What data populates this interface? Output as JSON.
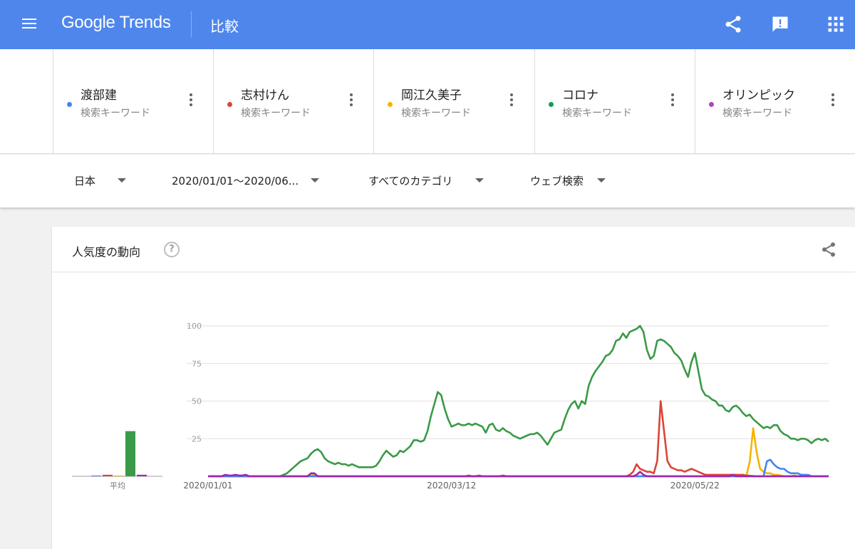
{
  "header": {
    "logo_text": "Google Trends",
    "title": "比較",
    "icons": [
      "menu-icon",
      "share-icon",
      "feedback-icon",
      "apps-icon"
    ],
    "color": "#4f86ec"
  },
  "terms": [
    {
      "name": "渡部建",
      "type": "検索キーワード",
      "color": "#4285f4"
    },
    {
      "name": "志村けん",
      "type": "検索キーワード",
      "color": "#db4437"
    },
    {
      "name": "岡江久美子",
      "type": "検索キーワード",
      "color": "#f4b400"
    },
    {
      "name": "コロナ",
      "type": "検索キーワード",
      "color": "#0f9d58"
    },
    {
      "name": "オリンピック",
      "type": "検索キーワード",
      "color": "#ab47bc"
    }
  ],
  "filters": {
    "region": "日本",
    "date_range": "2020/01/01〜2020/06...",
    "category": "すべてのカテゴリ",
    "search_type": "ウェブ検索"
  },
  "card": {
    "title": "人気度の動向"
  },
  "chart_data": [
    {
      "type": "bar",
      "xlabel": "平均",
      "categories": [
        "渡部建",
        "志村けん",
        "岡江久美子",
        "コロナ",
        "オリンピック"
      ],
      "values": [
        0.3,
        1,
        0.3,
        30,
        1
      ],
      "colors": [
        "#4285f4",
        "#db4437",
        "#f4b400",
        "#3a9a47",
        "#9c27b0"
      ],
      "ylim": [
        0,
        100
      ]
    },
    {
      "type": "line",
      "ylim": [
        0,
        100
      ],
      "yticks": [
        25,
        50,
        75,
        100
      ],
      "xticks": [
        "2020/01/01",
        "2020/03/12",
        "2020/05/22"
      ],
      "x_start": "2020/01/01",
      "x_end": "2020/06/30",
      "grid": true,
      "series": [
        {
          "name": "渡部建",
          "color": "#4285f4",
          "points": [
            [
              0,
              0
            ],
            [
              162,
              0
            ],
            [
              163,
              10
            ],
            [
              164,
              11
            ],
            [
              165,
              8
            ],
            [
              166,
              6
            ],
            [
              167,
              5
            ],
            [
              168,
              5
            ],
            [
              169,
              3
            ],
            [
              170,
              2
            ],
            [
              171,
              2
            ],
            [
              172,
              2
            ],
            [
              173,
              1
            ],
            [
              174,
              1
            ],
            [
              175,
              1
            ],
            [
              176,
              0
            ],
            [
              181,
              0
            ]
          ]
        },
        {
          "name": "志村けん",
          "color": "#db4437",
          "points": [
            [
              0,
              0
            ],
            [
              75,
              0
            ],
            [
              76,
              0.5
            ],
            [
              77,
              0
            ],
            [
              78,
              0
            ],
            [
              79,
              0.5
            ],
            [
              80,
              0
            ],
            [
              85,
              0
            ],
            [
              86,
              0.5
            ],
            [
              87,
              0
            ],
            [
              122,
              0
            ],
            [
              123,
              1
            ],
            [
              124,
              3
            ],
            [
              125,
              8
            ],
            [
              126,
              5
            ],
            [
              127,
              4
            ],
            [
              128,
              3
            ],
            [
              129,
              3
            ],
            [
              130,
              2
            ],
            [
              131,
              10
            ],
            [
              132,
              50
            ],
            [
              133,
              30
            ],
            [
              134,
              10
            ],
            [
              135,
              6
            ],
            [
              136,
              5
            ],
            [
              137,
              4
            ],
            [
              138,
              4
            ],
            [
              139,
              3
            ],
            [
              140,
              4
            ],
            [
              141,
              5
            ],
            [
              142,
              4
            ],
            [
              143,
              3
            ],
            [
              144,
              2
            ],
            [
              145,
              1
            ],
            [
              146,
              1
            ],
            [
              150,
              1
            ],
            [
              156,
              1
            ],
            [
              157,
              0.5
            ],
            [
              160,
              0
            ],
            [
              181,
              0
            ]
          ]
        },
        {
          "name": "岡江久美子",
          "color": "#f4b400",
          "points": [
            [
              0,
              0
            ],
            [
              29,
              0
            ],
            [
              30,
              0.5
            ],
            [
              31,
              1
            ],
            [
              32,
              0
            ],
            [
              157,
              0
            ],
            [
              158,
              10
            ],
            [
              159,
              32
            ],
            [
              160,
              16
            ],
            [
              161,
              5
            ],
            [
              162,
              3
            ],
            [
              163,
              2
            ],
            [
              164,
              2
            ],
            [
              165,
              1
            ],
            [
              166,
              1
            ],
            [
              167,
              0.5
            ],
            [
              168,
              0
            ],
            [
              170,
              0
            ],
            [
              171,
              0.5
            ],
            [
              172,
              0
            ],
            [
              181,
              0
            ]
          ]
        },
        {
          "name": "コロナ",
          "color": "#3a9a47",
          "points": [
            [
              0,
              0
            ],
            [
              20,
              0
            ],
            [
              21,
              0
            ],
            [
              22,
              1
            ],
            [
              23,
              2
            ],
            [
              24,
              4
            ],
            [
              25,
              6
            ],
            [
              26,
              8
            ],
            [
              27,
              10
            ],
            [
              28,
              11
            ],
            [
              29,
              12
            ],
            [
              30,
              15
            ],
            [
              31,
              17
            ],
            [
              32,
              18
            ],
            [
              33,
              16
            ],
            [
              34,
              12
            ],
            [
              35,
              10
            ],
            [
              36,
              9
            ],
            [
              37,
              8
            ],
            [
              38,
              9
            ],
            [
              39,
              8
            ],
            [
              40,
              8
            ],
            [
              41,
              7
            ],
            [
              42,
              8
            ],
            [
              43,
              7
            ],
            [
              44,
              6
            ],
            [
              45,
              6
            ],
            [
              46,
              6
            ],
            [
              47,
              6
            ],
            [
              48,
              6
            ],
            [
              49,
              7
            ],
            [
              50,
              10
            ],
            [
              51,
              14
            ],
            [
              52,
              17
            ],
            [
              53,
              15
            ],
            [
              54,
              13
            ],
            [
              55,
              14
            ],
            [
              56,
              17
            ],
            [
              57,
              16
            ],
            [
              58,
              18
            ],
            [
              59,
              20
            ],
            [
              60,
              24
            ],
            [
              61,
              24
            ],
            [
              62,
              23
            ],
            [
              63,
              24
            ],
            [
              64,
              30
            ],
            [
              65,
              40
            ],
            [
              66,
              48
            ],
            [
              67,
              56
            ],
            [
              68,
              54
            ],
            [
              69,
              45
            ],
            [
              70,
              38
            ],
            [
              71,
              33
            ],
            [
              72,
              34
            ],
            [
              73,
              35
            ],
            [
              74,
              34
            ],
            [
              75,
              34
            ],
            [
              76,
              35
            ],
            [
              77,
              34
            ],
            [
              78,
              35
            ],
            [
              79,
              34
            ],
            [
              80,
              33
            ],
            [
              81,
              29
            ],
            [
              82,
              34
            ],
            [
              83,
              35
            ],
            [
              84,
              31
            ],
            [
              85,
              30
            ],
            [
              86,
              32
            ],
            [
              87,
              30
            ],
            [
              88,
              29
            ],
            [
              89,
              27
            ],
            [
              90,
              26
            ],
            [
              91,
              25
            ],
            [
              92,
              26
            ],
            [
              93,
              27
            ],
            [
              94,
              28
            ],
            [
              95,
              28
            ],
            [
              96,
              29
            ],
            [
              97,
              27
            ],
            [
              98,
              24
            ],
            [
              99,
              21
            ],
            [
              100,
              25
            ],
            [
              101,
              29
            ],
            [
              102,
              30
            ],
            [
              103,
              31
            ],
            [
              104,
              38
            ],
            [
              105,
              44
            ],
            [
              106,
              48
            ],
            [
              107,
              50
            ],
            [
              108,
              45
            ],
            [
              109,
              50
            ],
            [
              110,
              48
            ],
            [
              111,
              60
            ],
            [
              112,
              66
            ],
            [
              113,
              70
            ],
            [
              114,
              73
            ],
            [
              115,
              76
            ],
            [
              116,
              80
            ],
            [
              117,
              81
            ],
            [
              118,
              84
            ],
            [
              119,
              90
            ],
            [
              120,
              91
            ],
            [
              121,
              95
            ],
            [
              122,
              92
            ],
            [
              123,
              96
            ],
            [
              124,
              97
            ],
            [
              125,
              98
            ],
            [
              126,
              100
            ],
            [
              127,
              96
            ],
            [
              128,
              84
            ],
            [
              129,
              78
            ],
            [
              130,
              80
            ],
            [
              131,
              90
            ],
            [
              132,
              91
            ],
            [
              133,
              90
            ],
            [
              134,
              88
            ],
            [
              135,
              86
            ],
            [
              136,
              82
            ],
            [
              137,
              80
            ],
            [
              138,
              77
            ],
            [
              139,
              71
            ],
            [
              140,
              66
            ],
            [
              141,
              76
            ],
            [
              142,
              82
            ],
            [
              143,
              70
            ],
            [
              144,
              58
            ],
            [
              145,
              54
            ],
            [
              146,
              53
            ],
            [
              147,
              51
            ],
            [
              148,
              50
            ],
            [
              149,
              47
            ],
            [
              150,
              47
            ],
            [
              151,
              44
            ],
            [
              152,
              43
            ],
            [
              153,
              46
            ],
            [
              154,
              47
            ],
            [
              155,
              45
            ],
            [
              156,
              42
            ],
            [
              157,
              40
            ],
            [
              158,
              41
            ],
            [
              159,
              38
            ],
            [
              160,
              36
            ],
            [
              161,
              34
            ],
            [
              162,
              32
            ],
            [
              163,
              33
            ],
            [
              164,
              32
            ],
            [
              165,
              34
            ],
            [
              166,
              34
            ],
            [
              167,
              30
            ],
            [
              168,
              28
            ],
            [
              169,
              27
            ],
            [
              170,
              25
            ],
            [
              171,
              25
            ],
            [
              172,
              24
            ],
            [
              173,
              25
            ],
            [
              174,
              25
            ],
            [
              175,
              24
            ],
            [
              176,
              22
            ],
            [
              177,
              24
            ],
            [
              178,
              25
            ],
            [
              179,
              24
            ],
            [
              180,
              25
            ],
            [
              181,
              23
            ]
          ]
        },
        {
          "name": "オリンピック",
          "color": "#9c27b0",
          "points": [
            [
              0,
              0
            ],
            [
              4,
              0
            ],
            [
              5,
              1
            ],
            [
              6,
              0.5
            ],
            [
              7,
              0.5
            ],
            [
              8,
              1
            ],
            [
              9,
              0.5
            ],
            [
              10,
              0.5
            ],
            [
              11,
              1
            ],
            [
              12,
              0
            ],
            [
              29,
              0
            ],
            [
              30,
              2
            ],
            [
              31,
              2
            ],
            [
              32,
              0
            ],
            [
              124,
              0
            ],
            [
              125,
              1
            ],
            [
              126,
              3
            ],
            [
              127,
              1
            ],
            [
              128,
              0
            ],
            [
              152,
              0
            ],
            [
              153,
              1
            ],
            [
              154,
              0
            ],
            [
              181,
              0
            ]
          ]
        }
      ]
    }
  ]
}
